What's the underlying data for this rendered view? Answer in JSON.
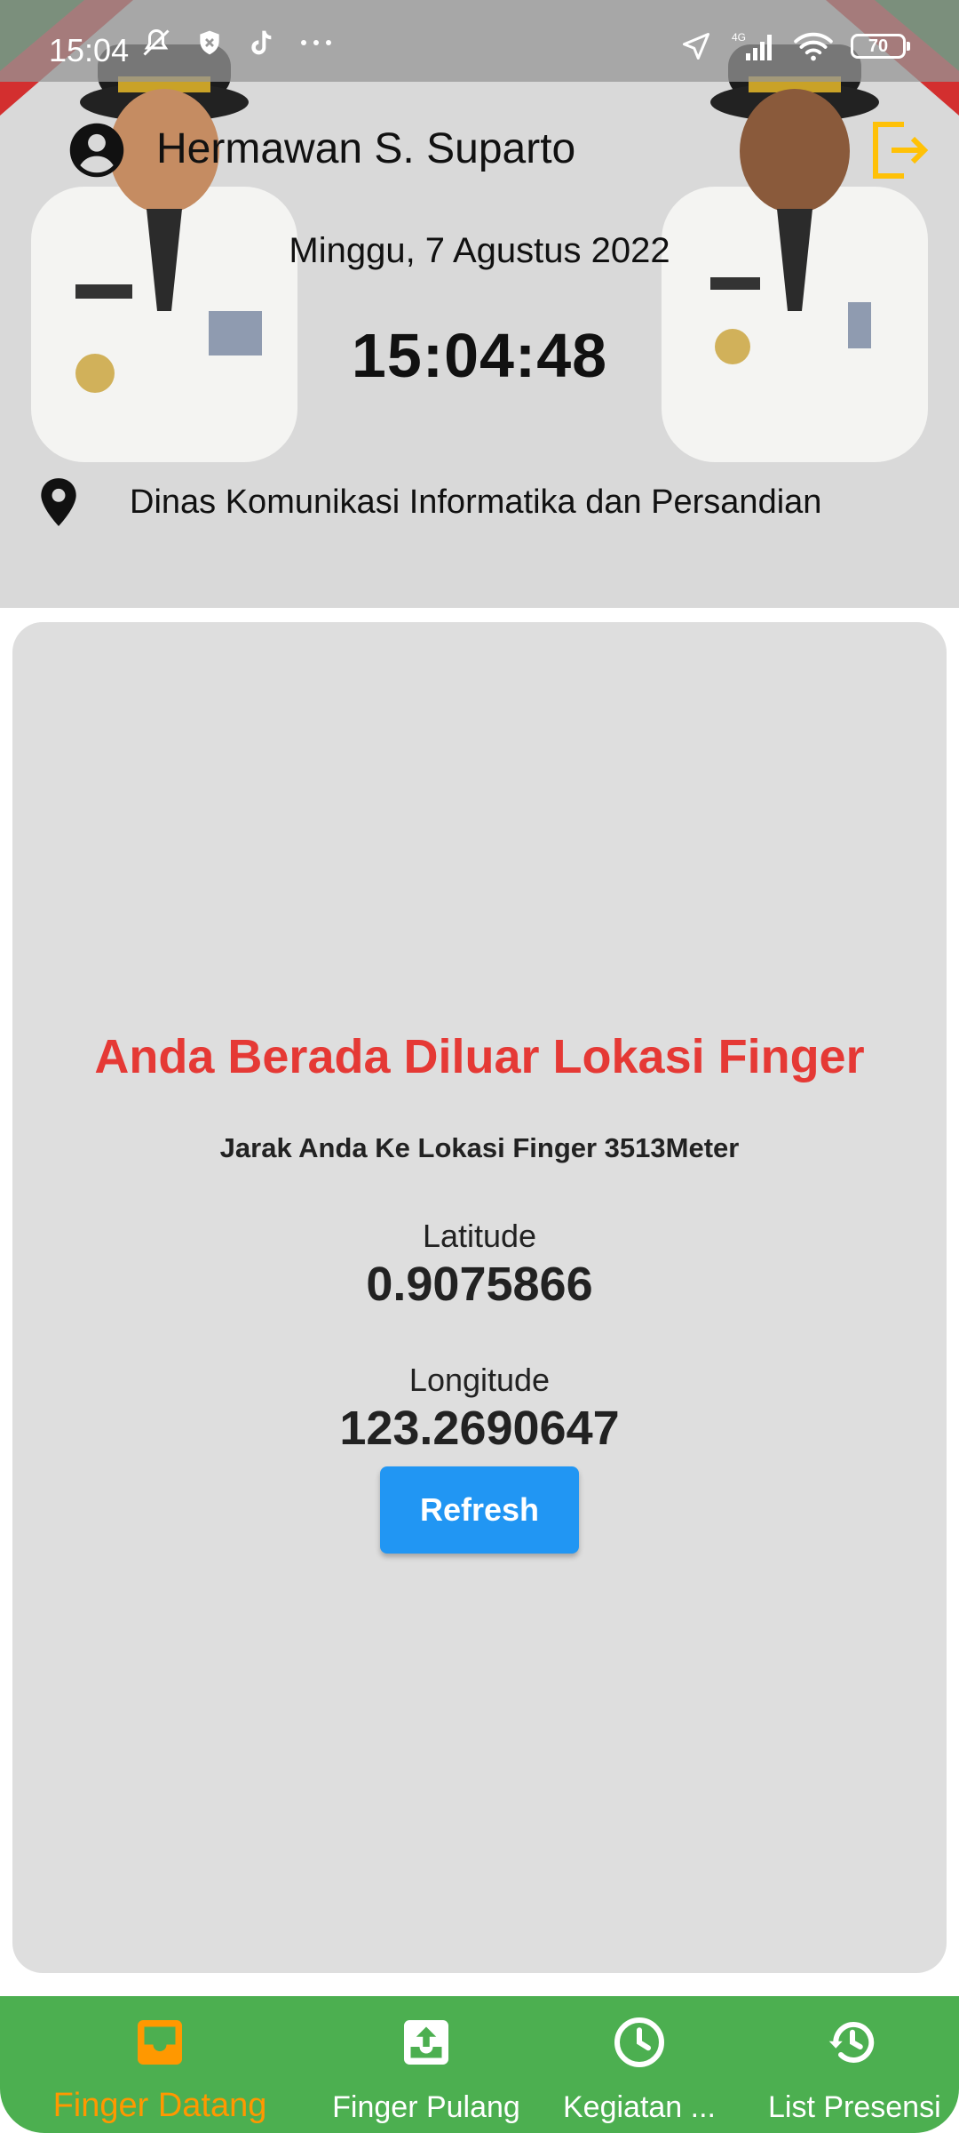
{
  "status_bar": {
    "time": "15:04",
    "icons_left": [
      "mute-icon",
      "shield-icon",
      "tiktok-icon",
      "more-icon"
    ],
    "network": "4G",
    "battery": "70"
  },
  "header": {
    "user_name": "Hermawan S. Suparto",
    "date": "Minggu, 7 Agustus 2022",
    "clock": "15:04:48",
    "location": "Dinas Komunikasi Informatika dan Persandian",
    "accent_color": "#ffc107"
  },
  "card": {
    "warning_title": "Anda Berada Diluar Lokasi Finger",
    "distance": "Jarak Anda Ke Lokasi Finger 3513Meter",
    "latitude_label": "Latitude",
    "latitude_value": "0.9075866",
    "longitude_label": "Longitude",
    "longitude_value": "123.2690647",
    "refresh_label": "Refresh"
  },
  "bottom_nav": {
    "items": [
      {
        "label": "Finger Datang",
        "icon": "inbox-tray-icon",
        "active": true
      },
      {
        "label": "Finger Pulang",
        "icon": "upload-box-icon",
        "active": false
      },
      {
        "label": "Kegiatan ...",
        "icon": "clock-icon",
        "active": false
      },
      {
        "label": "List Presensi",
        "icon": "history-icon",
        "active": false
      }
    ],
    "active_color": "#ff9800",
    "bar_color": "#4caf50"
  }
}
